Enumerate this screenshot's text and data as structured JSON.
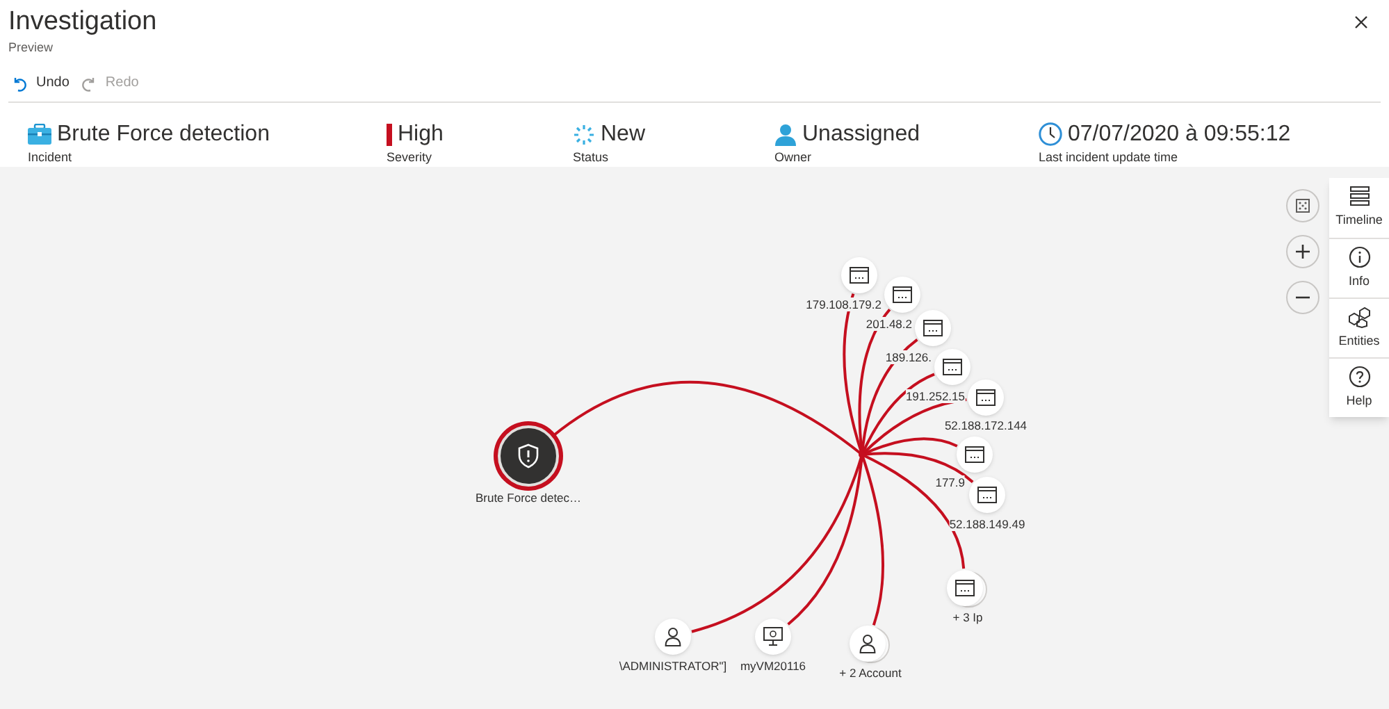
{
  "window": {
    "title": "Investigation",
    "subtitle": "Preview"
  },
  "toolbar": [
    {
      "kind": "undo",
      "label": "Undo",
      "disabled": false
    },
    {
      "kind": "redo",
      "label": "Redo",
      "disabled": true
    }
  ],
  "summary": [
    {
      "kind": "incident",
      "value": "Brute Force detection",
      "label": "Incident"
    },
    {
      "kind": "severity",
      "value": "High",
      "label": "Severity"
    },
    {
      "kind": "status",
      "value": "New",
      "label": "Status"
    },
    {
      "kind": "owner",
      "value": "Unassigned",
      "label": "Owner"
    },
    {
      "kind": "time",
      "value": "07/07/2020 à 09:55:12",
      "label": "Last incident update time"
    }
  ],
  "graph": {
    "nodes": [
      {
        "kind": "alert",
        "label": "Brute Force detec…",
        "selected": true
      },
      {
        "kind": "ip",
        "label": "179.108.179.2",
        "selected": false
      },
      {
        "kind": "ip",
        "label": "201.48.2",
        "selected": false
      },
      {
        "kind": "ip",
        "label": "189.126.",
        "selected": false
      },
      {
        "kind": "ip",
        "label": "191.252.15",
        "selected": false
      },
      {
        "kind": "ip",
        "label": "52.188.172.144",
        "selected": false
      },
      {
        "kind": "ip",
        "label": "177.9",
        "selected": false
      },
      {
        "kind": "ip",
        "label": "52.188.149.49",
        "selected": false
      },
      {
        "kind": "ip",
        "label": "+ 3 Ip",
        "stacked": true,
        "selected": false
      },
      {
        "kind": "account",
        "label": "\\ADMINISTRATOR\"]",
        "selected": false
      },
      {
        "kind": "host",
        "label": "myVM20116",
        "selected": false
      },
      {
        "kind": "account",
        "label": "+ 2 Account",
        "stacked": true,
        "selected": false
      }
    ]
  },
  "side_panel": [
    {
      "kind": "timeline",
      "label": "Timeline"
    },
    {
      "kind": "info",
      "label": "Info"
    },
    {
      "kind": "entities",
      "label": "Entities"
    },
    {
      "kind": "help",
      "label": "Help"
    }
  ]
}
